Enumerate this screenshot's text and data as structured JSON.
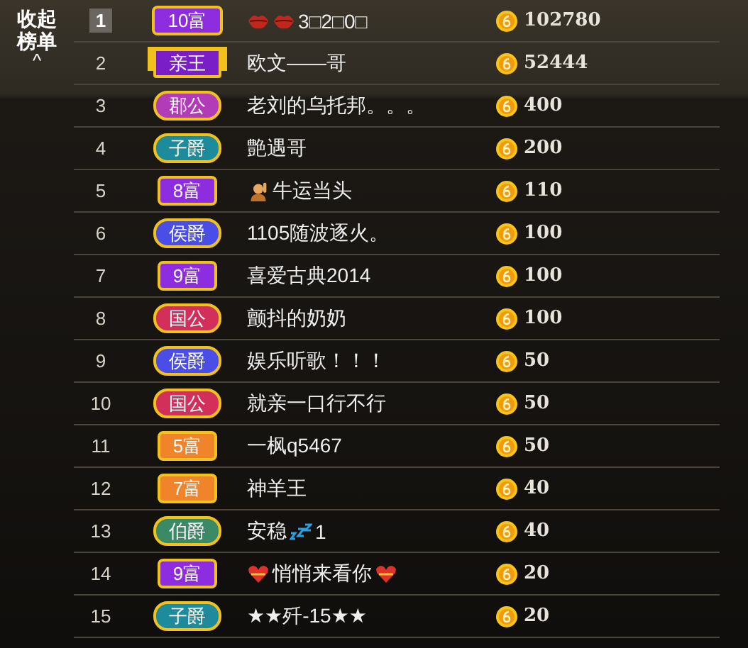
{
  "collapse": {
    "label": "收起榜单",
    "arrow": "^"
  },
  "rows": [
    {
      "rank": "1",
      "boxed": true,
      "badge": {
        "kind": "rich",
        "label": "10富",
        "color": "#8e2de0"
      },
      "name": [
        {
          "kind": "lips"
        },
        {
          "kind": "lips"
        },
        {
          "kind": "text",
          "text": "3□2□0□"
        }
      ],
      "amount": "102780"
    },
    {
      "rank": "2",
      "boxed": false,
      "badge": {
        "kind": "winged",
        "label": "亲王",
        "color": "#7a1fc8"
      },
      "name": [
        {
          "kind": "text",
          "text": "欧文——哥"
        }
      ],
      "amount": "52444"
    },
    {
      "rank": "3",
      "boxed": false,
      "badge": {
        "kind": "noble",
        "label": "郡公",
        "color": "#b23cb8"
      },
      "name": [
        {
          "kind": "text",
          "text": "老刘的乌托邦。。。"
        }
      ],
      "amount": "400"
    },
    {
      "rank": "4",
      "boxed": false,
      "badge": {
        "kind": "noble",
        "label": "子爵",
        "color": "#1d8b9b"
      },
      "name": [
        {
          "kind": "text",
          "text": "艶遇哥"
        }
      ],
      "amount": "200"
    },
    {
      "rank": "5",
      "boxed": false,
      "badge": {
        "kind": "rich",
        "label": "8富",
        "color": "#8e2de0"
      },
      "name": [
        {
          "kind": "person"
        },
        {
          "kind": "text",
          "text": "牛运当头"
        }
      ],
      "amount": "110"
    },
    {
      "rank": "6",
      "boxed": false,
      "badge": {
        "kind": "noble",
        "label": "侯爵",
        "color": "#4a4ee6"
      },
      "name": [
        {
          "kind": "text",
          "text": "1105随波逐火。"
        }
      ],
      "amount": "100"
    },
    {
      "rank": "7",
      "boxed": false,
      "badge": {
        "kind": "rich",
        "label": "9富",
        "color": "#8e2de0"
      },
      "name": [
        {
          "kind": "text",
          "text": "喜爱古典2014"
        }
      ],
      "amount": "100"
    },
    {
      "rank": "8",
      "boxed": false,
      "badge": {
        "kind": "noble",
        "label": "国公",
        "color": "#d2305a"
      },
      "name": [
        {
          "kind": "text",
          "text": "颤抖的奶奶"
        }
      ],
      "amount": "100"
    },
    {
      "rank": "9",
      "boxed": false,
      "badge": {
        "kind": "noble",
        "label": "侯爵",
        "color": "#4a4ee6"
      },
      "name": [
        {
          "kind": "text",
          "text": "娱乐听歌！！！"
        }
      ],
      "amount": "50"
    },
    {
      "rank": "10",
      "boxed": false,
      "badge": {
        "kind": "noble",
        "label": "国公",
        "color": "#d2305a"
      },
      "name": [
        {
          "kind": "text",
          "text": "就亲一口行不行"
        }
      ],
      "amount": "50"
    },
    {
      "rank": "11",
      "boxed": false,
      "badge": {
        "kind": "rich",
        "label": "5富",
        "color": "#f0842a"
      },
      "name": [
        {
          "kind": "text",
          "text": "一枫q5467"
        }
      ],
      "amount": "50"
    },
    {
      "rank": "12",
      "boxed": false,
      "badge": {
        "kind": "rich",
        "label": "7富",
        "color": "#f0842a"
      },
      "name": [
        {
          "kind": "text",
          "text": "神羊王"
        }
      ],
      "amount": "40"
    },
    {
      "rank": "13",
      "boxed": false,
      "badge": {
        "kind": "noble",
        "label": "伯爵",
        "color": "#3a8a66"
      },
      "name": [
        {
          "kind": "text",
          "text": "安稳"
        },
        {
          "kind": "sleep"
        },
        {
          "kind": "text",
          "text": "1"
        }
      ],
      "amount": "40"
    },
    {
      "rank": "14",
      "boxed": false,
      "badge": {
        "kind": "rich",
        "label": "9富",
        "color": "#8e2de0"
      },
      "name": [
        {
          "kind": "heart"
        },
        {
          "kind": "text",
          "text": "悄悄来看你"
        },
        {
          "kind": "heart"
        }
      ],
      "amount": "20"
    },
    {
      "rank": "15",
      "boxed": false,
      "badge": {
        "kind": "noble",
        "label": "子爵",
        "color": "#1d8b9b"
      },
      "name": [
        {
          "kind": "text",
          "text": "★★歼-15★★"
        }
      ],
      "amount": "20"
    }
  ]
}
